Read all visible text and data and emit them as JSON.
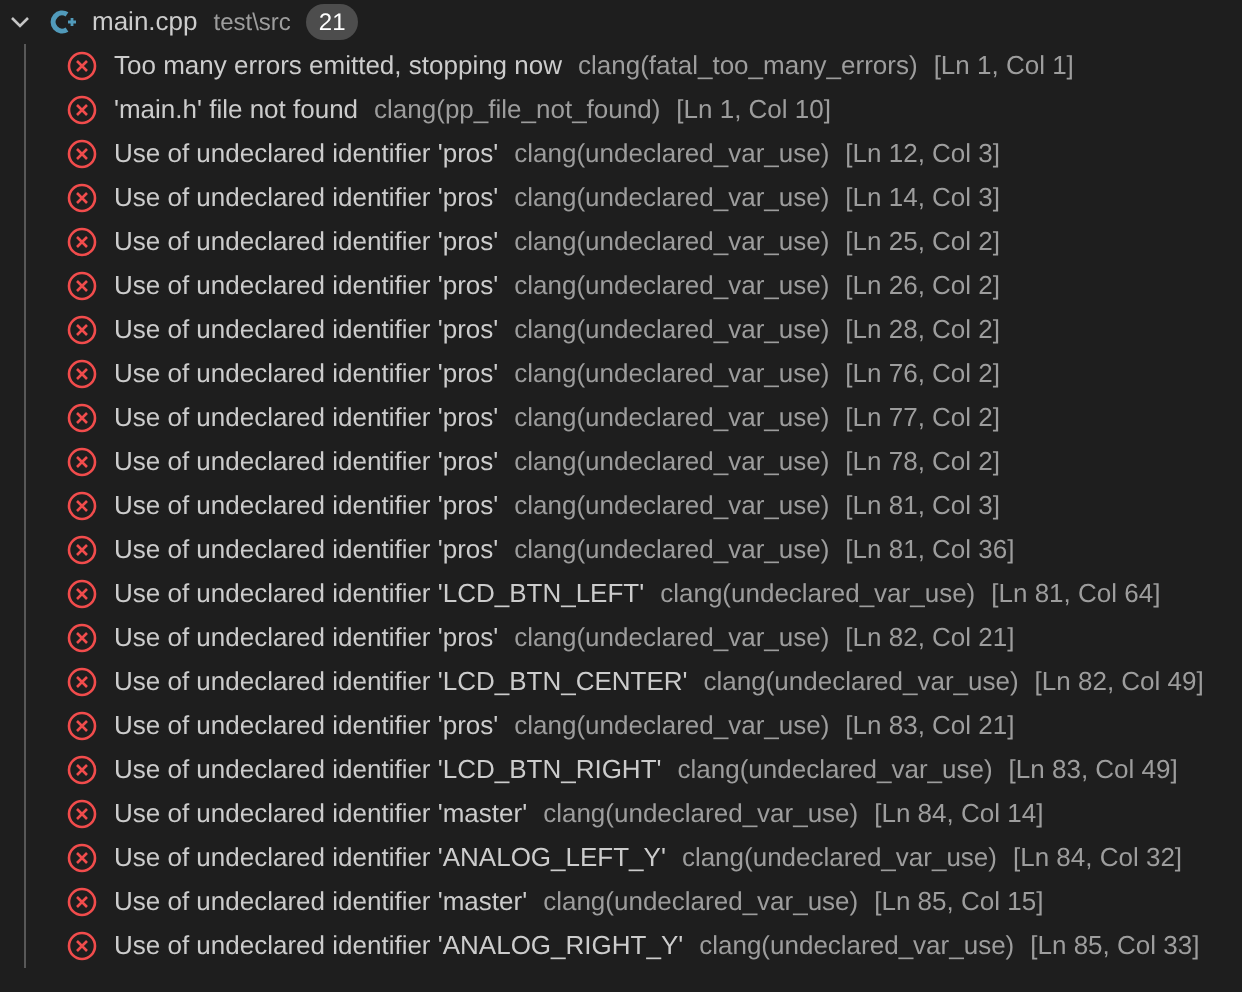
{
  "file": {
    "name": "main.cpp",
    "path": "test\\src",
    "count": "21",
    "expanded": true
  },
  "problems": [
    {
      "message": "Too many errors emitted, stopping now",
      "source": "clang(fatal_too_many_errors)",
      "location": "[Ln 1, Col 1]"
    },
    {
      "message": "'main.h' file not found",
      "source": "clang(pp_file_not_found)",
      "location": "[Ln 1, Col 10]"
    },
    {
      "message": "Use of undeclared identifier 'pros'",
      "source": "clang(undeclared_var_use)",
      "location": "[Ln 12, Col 3]"
    },
    {
      "message": "Use of undeclared identifier 'pros'",
      "source": "clang(undeclared_var_use)",
      "location": "[Ln 14, Col 3]"
    },
    {
      "message": "Use of undeclared identifier 'pros'",
      "source": "clang(undeclared_var_use)",
      "location": "[Ln 25, Col 2]"
    },
    {
      "message": "Use of undeclared identifier 'pros'",
      "source": "clang(undeclared_var_use)",
      "location": "[Ln 26, Col 2]"
    },
    {
      "message": "Use of undeclared identifier 'pros'",
      "source": "clang(undeclared_var_use)",
      "location": "[Ln 28, Col 2]"
    },
    {
      "message": "Use of undeclared identifier 'pros'",
      "source": "clang(undeclared_var_use)",
      "location": "[Ln 76, Col 2]"
    },
    {
      "message": "Use of undeclared identifier 'pros'",
      "source": "clang(undeclared_var_use)",
      "location": "[Ln 77, Col 2]"
    },
    {
      "message": "Use of undeclared identifier 'pros'",
      "source": "clang(undeclared_var_use)",
      "location": "[Ln 78, Col 2]"
    },
    {
      "message": "Use of undeclared identifier 'pros'",
      "source": "clang(undeclared_var_use)",
      "location": "[Ln 81, Col 3]"
    },
    {
      "message": "Use of undeclared identifier 'pros'",
      "source": "clang(undeclared_var_use)",
      "location": "[Ln 81, Col 36]"
    },
    {
      "message": "Use of undeclared identifier 'LCD_BTN_LEFT'",
      "source": "clang(undeclared_var_use)",
      "location": "[Ln 81, Col 64]"
    },
    {
      "message": "Use of undeclared identifier 'pros'",
      "source": "clang(undeclared_var_use)",
      "location": "[Ln 82, Col 21]"
    },
    {
      "message": "Use of undeclared identifier 'LCD_BTN_CENTER'",
      "source": "clang(undeclared_var_use)",
      "location": "[Ln 82, Col 49]"
    },
    {
      "message": "Use of undeclared identifier 'pros'",
      "source": "clang(undeclared_var_use)",
      "location": "[Ln 83, Col 21]"
    },
    {
      "message": "Use of undeclared identifier 'LCD_BTN_RIGHT'",
      "source": "clang(undeclared_var_use)",
      "location": "[Ln 83, Col 49]"
    },
    {
      "message": "Use of undeclared identifier 'master'",
      "source": "clang(undeclared_var_use)",
      "location": "[Ln 84, Col 14]"
    },
    {
      "message": "Use of undeclared identifier 'ANALOG_LEFT_Y'",
      "source": "clang(undeclared_var_use)",
      "location": "[Ln 84, Col 32]"
    },
    {
      "message": "Use of undeclared identifier 'master'",
      "source": "clang(undeclared_var_use)",
      "location": "[Ln 85, Col 15]"
    },
    {
      "message": "Use of undeclared identifier 'ANALOG_RIGHT_Y'",
      "source": "clang(undeclared_var_use)",
      "location": "[Ln 85, Col 33]"
    }
  ]
}
